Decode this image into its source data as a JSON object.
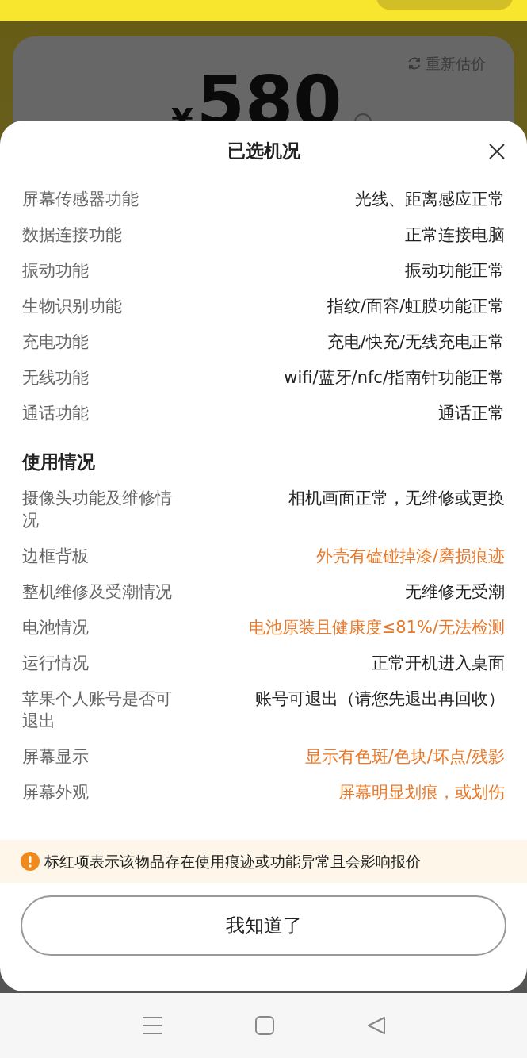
{
  "background": {
    "refresh_label": "重新估价",
    "currency": "¥",
    "price": "580"
  },
  "sheet": {
    "title": "已选机况",
    "sections": [
      {
        "rows": [
          {
            "label": "屏幕传感器功能",
            "value": "光线、距离感应正常",
            "abnormal": false
          },
          {
            "label": "数据连接功能",
            "value": "正常连接电脑",
            "abnormal": false
          },
          {
            "label": "振动功能",
            "value": "振动功能正常",
            "abnormal": false
          },
          {
            "label": "生物识别功能",
            "value": "指纹/面容/虹膜功能正常",
            "abnormal": false
          },
          {
            "label": "充电功能",
            "value": "充电/快充/无线充电正常",
            "abnormal": false
          },
          {
            "label": "无线功能",
            "value": "wifi/蓝牙/nfc/指南针功能正常",
            "abnormal": false
          },
          {
            "label": "通话功能",
            "value": "通话正常",
            "abnormal": false
          }
        ]
      },
      {
        "title": "使用情况",
        "rows": [
          {
            "label": "摄像头功能及维修情况",
            "value": "相机画面正常，无维修或更换",
            "abnormal": false
          },
          {
            "label": "边框背板",
            "value": "外壳有磕碰掉漆/磨损痕迹",
            "abnormal": true
          },
          {
            "label": "整机维修及受潮情况",
            "value": "无维修无受潮",
            "abnormal": false
          },
          {
            "label": "电池情况",
            "value": "电池原装且健康度≤81%/无法检测",
            "abnormal": true
          },
          {
            "label": "运行情况",
            "value": "正常开机进入桌面",
            "abnormal": false
          },
          {
            "label": "苹果个人账号是否可退出",
            "value": "账号可退出（请您先退出再回收）",
            "abnormal": false
          },
          {
            "label": "屏幕显示",
            "value": "显示有色斑/色块/坏点/残影",
            "abnormal": true
          },
          {
            "label": "屏幕外观",
            "value": "屏幕明显划痕，或划伤",
            "abnormal": true
          }
        ]
      }
    ],
    "notice": "标红项表示该物品存在使用痕迹或功能异常且会影响报价",
    "confirm_button": "我知道了"
  }
}
